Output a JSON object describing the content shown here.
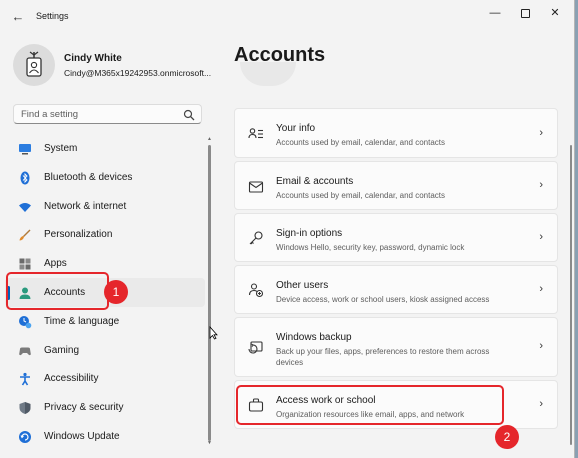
{
  "window": {
    "title": "Settings",
    "controls": {
      "minimize": "—",
      "maximize": "",
      "close": "✕"
    },
    "back_glyph": "←"
  },
  "user": {
    "name": "Cindy White",
    "email": "Cindy@M365x19242953.onmicrosoft..."
  },
  "search": {
    "placeholder": "Find a setting"
  },
  "sidebar": {
    "items": [
      {
        "label": "System",
        "icon": "system-icon"
      },
      {
        "label": "Bluetooth & devices",
        "icon": "bluetooth-icon"
      },
      {
        "label": "Network & internet",
        "icon": "wifi-icon"
      },
      {
        "label": "Personalization",
        "icon": "brush-icon"
      },
      {
        "label": "Apps",
        "icon": "apps-icon"
      },
      {
        "label": "Accounts",
        "icon": "accounts-icon",
        "selected": true
      },
      {
        "label": "Time & language",
        "icon": "time-language-icon"
      },
      {
        "label": "Gaming",
        "icon": "gaming-icon"
      },
      {
        "label": "Accessibility",
        "icon": "accessibility-icon"
      },
      {
        "label": "Privacy & security",
        "icon": "shield-icon"
      },
      {
        "label": "Windows Update",
        "icon": "windows-update-icon"
      }
    ]
  },
  "annotations": {
    "step1": "1",
    "step2": "2"
  },
  "main": {
    "title": "Accounts",
    "cards": [
      {
        "title": "Your info",
        "description": "Accounts used by email, calendar, and contacts",
        "icon": "person-card-icon"
      },
      {
        "title": "Email & accounts",
        "description": "Accounts used by email, calendar, and contacts",
        "icon": "mail-icon"
      },
      {
        "title": "Sign-in options",
        "description": "Windows Hello, security key, password, dynamic lock",
        "icon": "key-icon"
      },
      {
        "title": "Other users",
        "description": "Device access, work or school users, kiosk assigned access",
        "icon": "people-icon"
      },
      {
        "title": "Windows backup",
        "description": "Back up your files, apps, preferences to restore them across devices",
        "icon": "backup-icon"
      },
      {
        "title": "Access work or school",
        "description": "Organization resources like email, apps, and network",
        "icon": "briefcase-icon"
      }
    ]
  },
  "colors": {
    "accent": "#005fb8",
    "annotation": "#e5262b",
    "window_bg": "#f3f3f3",
    "card_bg": "#fbfbfb"
  }
}
